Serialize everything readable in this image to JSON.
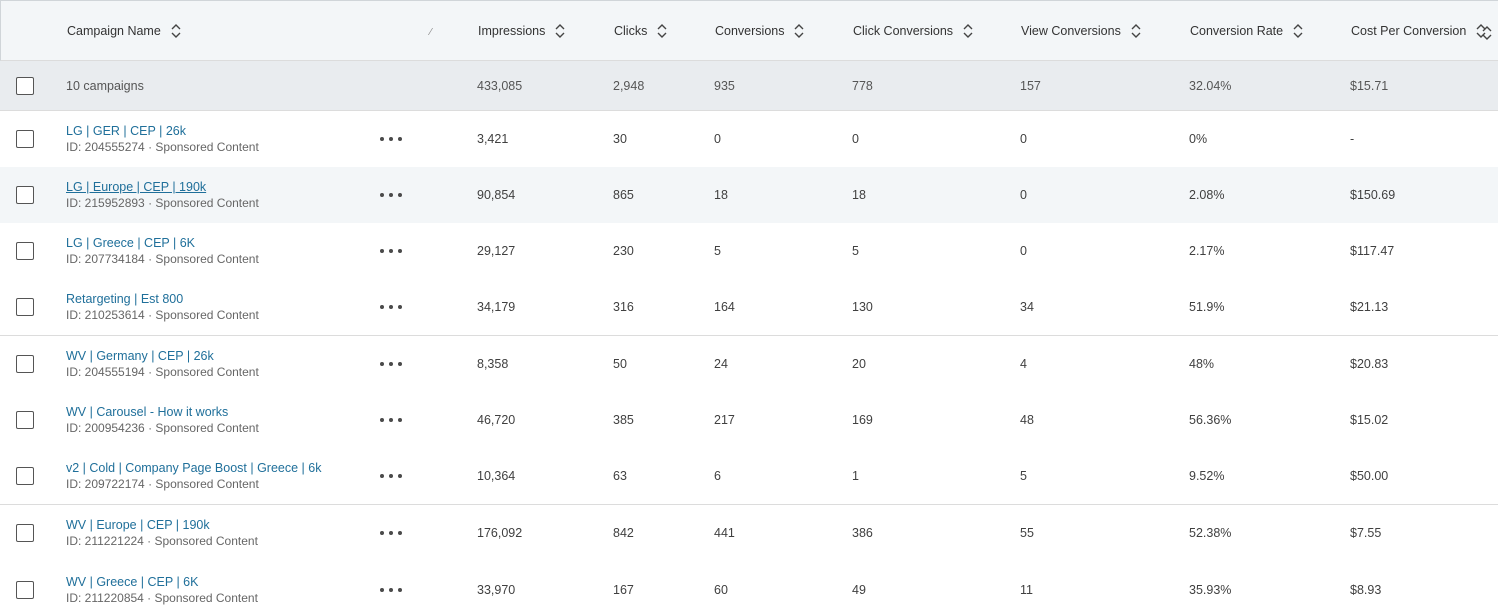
{
  "header": {
    "campaign_name": "Campaign Name",
    "impressions": "Impressions",
    "clicks": "Clicks",
    "conversions": "Conversions",
    "click_conversions": "Click Conversions",
    "view_conversions": "View Conversions",
    "conversion_rate": "Conversion Rate",
    "cost_per_conversion": "Cost Per Conversion"
  },
  "summary": {
    "label": "10 campaigns",
    "impressions": "433,085",
    "clicks": "2,948",
    "conversions": "935",
    "click_conversions": "778",
    "view_conversions": "157",
    "conversion_rate": "32.04%",
    "cost_per_conversion": "$15.71"
  },
  "rows": [
    {
      "name": "LG | GER | CEP | 26k",
      "sub": "ID: 204555274 · Sponsored Content",
      "impressions": "3,421",
      "clicks": "30",
      "conversions": "0",
      "click_conversions": "0",
      "view_conversions": "0",
      "conversion_rate": "0%",
      "cost_per_conversion": "-"
    },
    {
      "name": "LG | Europe | CEP | 190k",
      "sub": "ID: 215952893 · Sponsored Content",
      "impressions": "90,854",
      "clicks": "865",
      "conversions": "18",
      "click_conversions": "18",
      "view_conversions": "0",
      "conversion_rate": "2.08%",
      "cost_per_conversion": "$150.69"
    },
    {
      "name": "LG | Greece | CEP | 6K",
      "sub": "ID: 207734184 · Sponsored Content",
      "impressions": "29,127",
      "clicks": "230",
      "conversions": "5",
      "click_conversions": "5",
      "view_conversions": "0",
      "conversion_rate": "2.17%",
      "cost_per_conversion": "$117.47"
    },
    {
      "name": "Retargeting | Est 800",
      "sub": "ID: 210253614 · Sponsored Content",
      "impressions": "34,179",
      "clicks": "316",
      "conversions": "164",
      "click_conversions": "130",
      "view_conversions": "34",
      "conversion_rate": "51.9%",
      "cost_per_conversion": "$21.13"
    },
    {
      "name": "WV | Germany | CEP | 26k",
      "sub": "ID: 204555194 · Sponsored Content",
      "impressions": "8,358",
      "clicks": "50",
      "conversions": "24",
      "click_conversions": "20",
      "view_conversions": "4",
      "conversion_rate": "48%",
      "cost_per_conversion": "$20.83"
    },
    {
      "name": "WV | Carousel - How it works",
      "sub": "ID: 200954236 · Sponsored Content",
      "impressions": "46,720",
      "clicks": "385",
      "conversions": "217",
      "click_conversions": "169",
      "view_conversions": "48",
      "conversion_rate": "56.36%",
      "cost_per_conversion": "$15.02"
    },
    {
      "name": "v2 | Cold | Company Page Boost | Greece | 6k",
      "sub": "ID: 209722174 · Sponsored Content",
      "impressions": "10,364",
      "clicks": "63",
      "conversions": "6",
      "click_conversions": "1",
      "view_conversions": "5",
      "conversion_rate": "9.52%",
      "cost_per_conversion": "$50.00"
    },
    {
      "name": "WV | Europe | CEP | 190k",
      "sub": "ID: 211221224 · Sponsored Content",
      "impressions": "176,092",
      "clicks": "842",
      "conversions": "441",
      "click_conversions": "386",
      "view_conversions": "55",
      "conversion_rate": "52.38%",
      "cost_per_conversion": "$7.55"
    },
    {
      "name": "WV | Greece | CEP | 6K",
      "sub": "ID: 211220854 · Sponsored Content",
      "impressions": "33,970",
      "clicks": "167",
      "conversions": "60",
      "click_conversions": "49",
      "view_conversions": "11",
      "conversion_rate": "35.93%",
      "cost_per_conversion": "$8.93"
    }
  ],
  "icons": {
    "sort": "sort-up-down-icon",
    "more": "more-horizontal-icon",
    "checkbox": "checkbox-icon"
  },
  "colors": {
    "link": "#1f6f9a",
    "header_bg": "#f3f6f8",
    "summary_bg": "#e9ecef",
    "row_hover_bg": "#f3f6f8"
  }
}
